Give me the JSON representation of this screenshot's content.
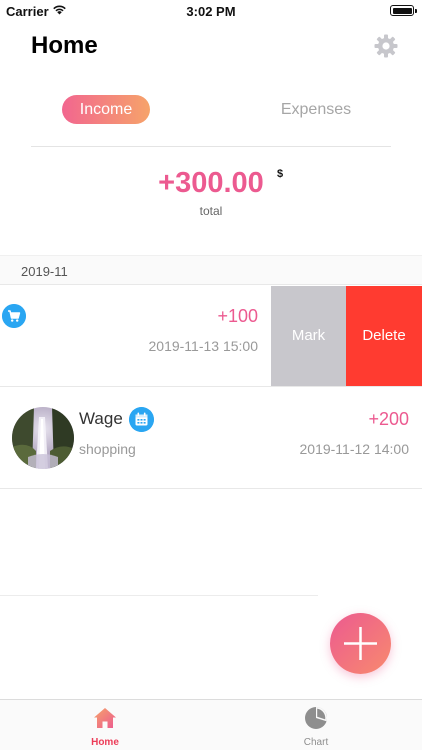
{
  "status_bar": {
    "carrier": "Carrier",
    "time": "3:02 PM"
  },
  "header": {
    "title": "Home"
  },
  "tabs": {
    "income": "Income",
    "expenses": "Expenses",
    "active": "Income"
  },
  "summary": {
    "amount": "+300.00",
    "currency": "$",
    "label": "total"
  },
  "section": {
    "date": "2019-11"
  },
  "transactions": [
    {
      "icon": "cart-icon",
      "title": "",
      "subtitle": "",
      "amount": "+100",
      "datetime": "2019-11-13 15:00",
      "swipe_actions": {
        "mark": "Mark",
        "delete": "Delete"
      }
    },
    {
      "icon": "calendar-icon",
      "title": "Wage",
      "subtitle": "shopping",
      "amount": "+200",
      "datetime": "2019-11-12 14:00"
    }
  ],
  "tabbar": {
    "home": "Home",
    "chart": "Chart",
    "active": "Home"
  },
  "colors": {
    "accent": "#ec5a90",
    "gradient_end": "#f6a36a",
    "delete": "#ff3b30",
    "mark": "#c8c7cc",
    "badge_blue": "#2aa6f2"
  }
}
